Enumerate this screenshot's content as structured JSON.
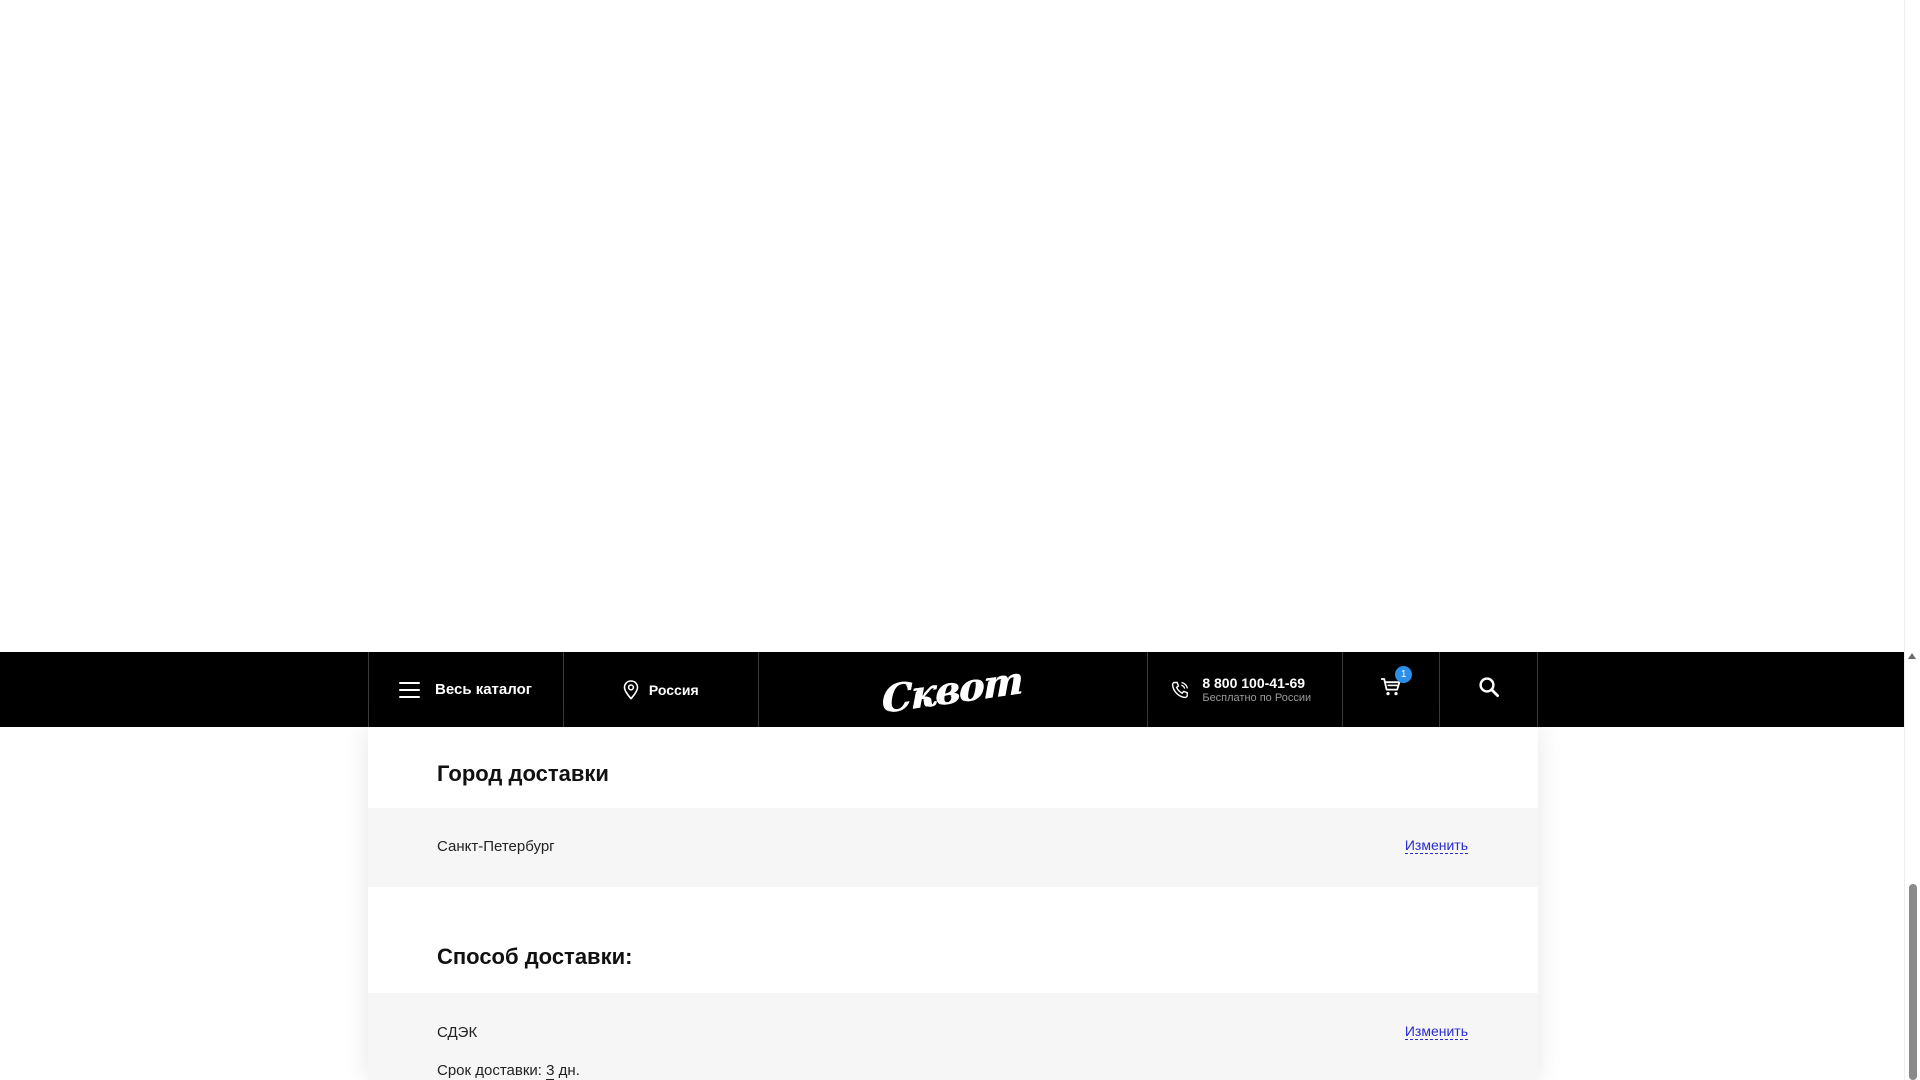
{
  "header": {
    "catalog_label": "Весь каталог",
    "region_label": "Россия",
    "logo_text": "Сквот",
    "phone_number": "8 800 100-41-69",
    "phone_caption": "Бесплатно по России",
    "cart_count": "1"
  },
  "delivery_city": {
    "title": "Город доставки",
    "value": "Санкт-Петербург",
    "change_label": "Изменить"
  },
  "delivery_method": {
    "title": "Способ доставки:",
    "value": "СДЭК",
    "change_label": "Изменить",
    "term_label": "Срок доставки:",
    "term_days": "3",
    "term_unit": "дн."
  },
  "colors": {
    "header_bg": "#000000",
    "badge": "#2b8ee8",
    "link": "#2a2ad0",
    "row_bg": "#f6f6f6"
  }
}
